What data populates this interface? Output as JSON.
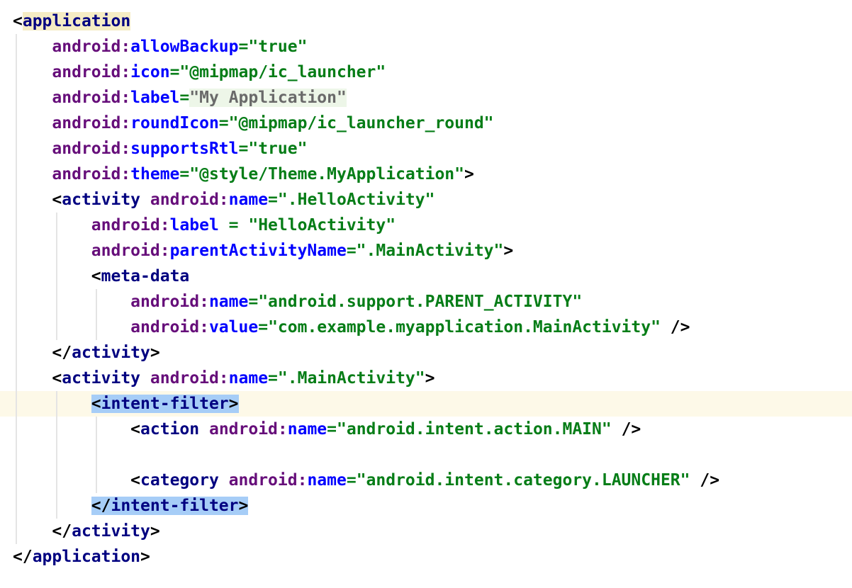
{
  "editor": {
    "language": "xml",
    "current_line": 15,
    "colors": {
      "tag": "#000080",
      "namespace": "#660e7a",
      "attribute": "#0000ff",
      "string": "#067d17",
      "tag_match_highlight": "#a6cdf7",
      "current_line": "#fdf9e8"
    },
    "lines": [
      {
        "indent": 0,
        "tokens": [
          [
            "p",
            "<"
          ],
          [
            "t hl-yellow",
            "application"
          ]
        ]
      },
      {
        "indent": 1,
        "tokens": [
          [
            "ns",
            "android:"
          ],
          [
            "a",
            "allowBackup"
          ],
          [
            "eq",
            "="
          ],
          [
            "s",
            "\"true\""
          ]
        ]
      },
      {
        "indent": 1,
        "tokens": [
          [
            "ns",
            "android:"
          ],
          [
            "a",
            "icon"
          ],
          [
            "eq",
            "="
          ],
          [
            "s",
            "\"@mipmap/ic_launcher\""
          ]
        ]
      },
      {
        "indent": 1,
        "tokens": [
          [
            "ns",
            "android:"
          ],
          [
            "a",
            "label"
          ],
          [
            "eq",
            "="
          ],
          [
            "sg",
            "\"My Application\""
          ]
        ]
      },
      {
        "indent": 1,
        "tokens": [
          [
            "ns",
            "android:"
          ],
          [
            "a",
            "roundIcon"
          ],
          [
            "eq",
            "="
          ],
          [
            "s",
            "\"@mipmap/ic_launcher_round\""
          ]
        ]
      },
      {
        "indent": 1,
        "tokens": [
          [
            "ns",
            "android:"
          ],
          [
            "a",
            "supportsRtl"
          ],
          [
            "eq",
            "="
          ],
          [
            "s",
            "\"true\""
          ]
        ]
      },
      {
        "indent": 1,
        "tokens": [
          [
            "ns",
            "android:"
          ],
          [
            "a",
            "theme"
          ],
          [
            "eq",
            "="
          ],
          [
            "s",
            "\"@style/Theme.MyApplication\""
          ],
          [
            "p",
            ">"
          ]
        ]
      },
      {
        "indent": 1,
        "tokens": [
          [
            "p",
            "<"
          ],
          [
            "t",
            "activity "
          ],
          [
            "ns",
            "android:"
          ],
          [
            "a",
            "name"
          ],
          [
            "eq",
            "="
          ],
          [
            "s",
            "\".HelloActivity\""
          ]
        ]
      },
      {
        "indent": 2,
        "tokens": [
          [
            "ns",
            "android:"
          ],
          [
            "a",
            "label"
          ],
          [
            "eq",
            " = "
          ],
          [
            "s",
            "\"HelloActivity\""
          ]
        ]
      },
      {
        "indent": 2,
        "tokens": [
          [
            "ns",
            "android:"
          ],
          [
            "a",
            "parentActivityName"
          ],
          [
            "eq",
            "="
          ],
          [
            "s",
            "\".MainActivity\""
          ],
          [
            "p",
            ">"
          ]
        ]
      },
      {
        "indent": 2,
        "tokens": [
          [
            "p",
            "<"
          ],
          [
            "t",
            "meta-data"
          ]
        ]
      },
      {
        "indent": 3,
        "tokens": [
          [
            "ns",
            "android:"
          ],
          [
            "a",
            "name"
          ],
          [
            "eq",
            "="
          ],
          [
            "s",
            "\"android.support.PARENT_ACTIVITY\""
          ]
        ]
      },
      {
        "indent": 3,
        "tokens": [
          [
            "ns",
            "android:"
          ],
          [
            "a",
            "value"
          ],
          [
            "eq",
            "="
          ],
          [
            "s",
            "\"com.example.myapplication.MainActivity\""
          ],
          [
            "p",
            " />"
          ]
        ]
      },
      {
        "indent": 1,
        "tokens": [
          [
            "p",
            "</"
          ],
          [
            "t",
            "activity"
          ],
          [
            "p",
            ">"
          ]
        ]
      },
      {
        "indent": 1,
        "tokens": [
          [
            "p",
            "<"
          ],
          [
            "t",
            "activity "
          ],
          [
            "ns",
            "android:"
          ],
          [
            "a",
            "name"
          ],
          [
            "eq",
            "="
          ],
          [
            "s",
            "\".MainActivity\""
          ],
          [
            "p",
            ">"
          ]
        ]
      },
      {
        "indent": 2,
        "tokens": [
          [
            "p hl-blue",
            "<"
          ],
          [
            "t hl-blue",
            "intent-filter"
          ],
          [
            "p hl-blue",
            ">"
          ]
        ]
      },
      {
        "indent": 3,
        "tokens": [
          [
            "p",
            "<"
          ],
          [
            "t",
            "action "
          ],
          [
            "ns",
            "android:"
          ],
          [
            "a",
            "name"
          ],
          [
            "eq",
            "="
          ],
          [
            "s",
            "\"android.intent.action.MAIN\""
          ],
          [
            "p",
            " />"
          ]
        ]
      },
      {
        "indent": 3,
        "tokens": []
      },
      {
        "indent": 3,
        "tokens": [
          [
            "p",
            "<"
          ],
          [
            "t",
            "category "
          ],
          [
            "ns",
            "android:"
          ],
          [
            "a",
            "name"
          ],
          [
            "eq",
            "="
          ],
          [
            "s",
            "\"android.intent.category.LAUNCHER\""
          ],
          [
            "p",
            " />"
          ]
        ]
      },
      {
        "indent": 2,
        "tokens": [
          [
            "p hl-blue",
            "</"
          ],
          [
            "t hl-blue",
            "intent-filter"
          ],
          [
            "p hl-blue",
            ">"
          ]
        ]
      },
      {
        "indent": 1,
        "tokens": [
          [
            "p",
            "</"
          ],
          [
            "t",
            "activity"
          ],
          [
            "p",
            ">"
          ]
        ]
      },
      {
        "indent": 0,
        "tokens": [
          [
            "p",
            "</"
          ],
          [
            "t",
            "application"
          ],
          [
            "p",
            ">"
          ]
        ]
      }
    ]
  }
}
